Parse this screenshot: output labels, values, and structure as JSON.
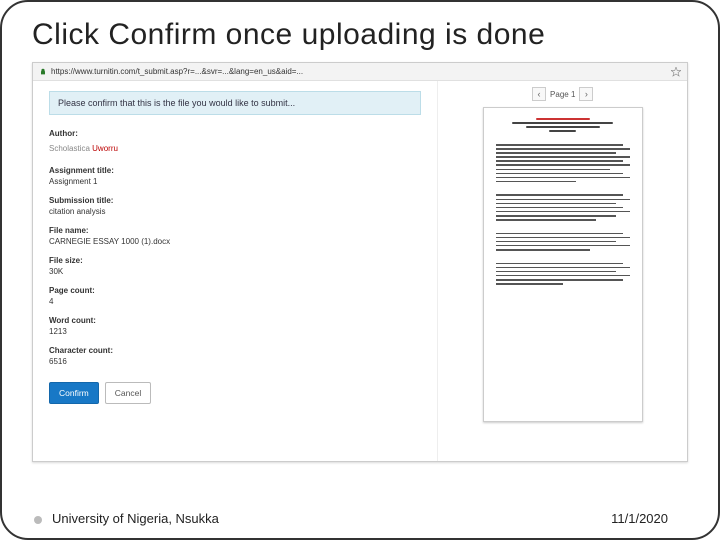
{
  "slide": {
    "title": "Click Confirm once uploading is done"
  },
  "url": "https://www.turnitin.com/t_submit.asp?r=...&svr=...&lang=en_us&aid=...",
  "alert": "Please confirm that this is the file you would like to submit...",
  "meta": {
    "author_label": "Author:",
    "author_value_a": "Scholastica",
    "author_value_b": "Uworru",
    "assignment_label": "Assignment title:",
    "assignment_value": "Assignment 1",
    "submission_label": "Submission title:",
    "submission_value": "citation analysis",
    "filename_label": "File name:",
    "filename_value": "CARNEGIE ESSAY 1000 (1).docx",
    "filesize_label": "File size:",
    "filesize_value": "30K",
    "pagecount_label": "Page count:",
    "pagecount_value": "4",
    "wordcount_label": "Word count:",
    "wordcount_value": "1213",
    "charcount_label": "Character count:",
    "charcount_value": "6516"
  },
  "pager": {
    "label": "Page 1"
  },
  "buttons": {
    "confirm": "Confirm",
    "cancel": "Cancel"
  },
  "footer": {
    "left": "University of Nigeria, Nsukka",
    "right": "11/1/2020"
  }
}
